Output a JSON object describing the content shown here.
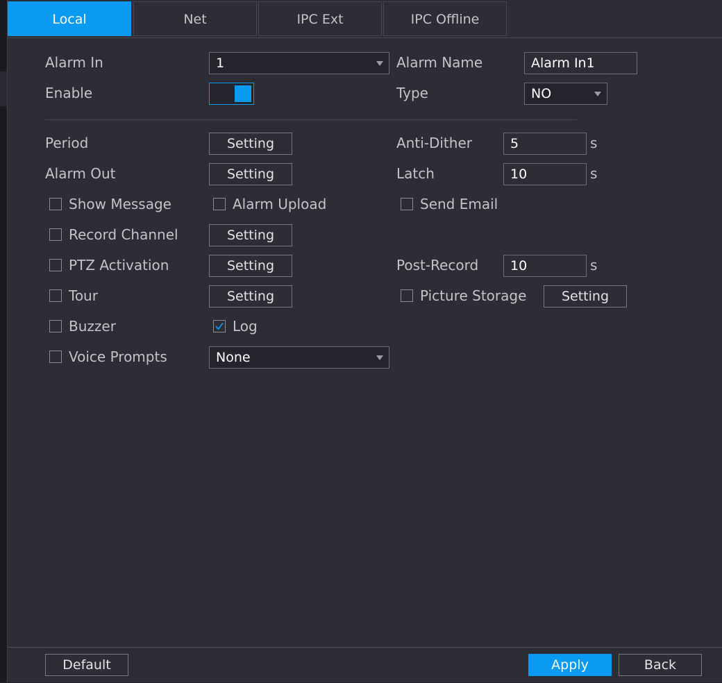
{
  "tabs": [
    "Local",
    "Net",
    "IPC Ext",
    "IPC Offline"
  ],
  "active_tab": "Local",
  "alarm_in": {
    "label": "Alarm In",
    "value": "1"
  },
  "alarm_name": {
    "label": "Alarm Name",
    "value": "Alarm In1"
  },
  "enable": {
    "label": "Enable",
    "on": true
  },
  "type": {
    "label": "Type",
    "value": "NO"
  },
  "period": {
    "label": "Period",
    "button": "Setting"
  },
  "anti_dither": {
    "label": "Anti-Dither",
    "value": "5",
    "unit": "s"
  },
  "alarm_out": {
    "label": "Alarm Out",
    "button": "Setting"
  },
  "latch": {
    "label": "Latch",
    "value": "10",
    "unit": "s"
  },
  "show_message": {
    "label": "Show Message",
    "checked": false
  },
  "alarm_upload": {
    "label": "Alarm Upload",
    "checked": false
  },
  "send_email": {
    "label": "Send Email",
    "checked": false
  },
  "record_channel": {
    "label": "Record Channel",
    "checked": false,
    "button": "Setting"
  },
  "ptz_activation": {
    "label": "PTZ Activation",
    "checked": false,
    "button": "Setting"
  },
  "post_record": {
    "label": "Post-Record",
    "value": "10",
    "unit": "s"
  },
  "tour": {
    "label": "Tour",
    "checked": false,
    "button": "Setting"
  },
  "picture_storage": {
    "label": "Picture Storage",
    "checked": false,
    "button": "Setting"
  },
  "buzzer": {
    "label": "Buzzer",
    "checked": false
  },
  "log": {
    "label": "Log",
    "checked": true
  },
  "voice_prompts": {
    "label": "Voice Prompts",
    "checked": false,
    "value": "None"
  },
  "footer": {
    "default": "Default",
    "apply": "Apply",
    "back": "Back"
  },
  "colors": {
    "accent": "#0a9af2",
    "panel": "#2c2d35",
    "background": "#22232a"
  }
}
